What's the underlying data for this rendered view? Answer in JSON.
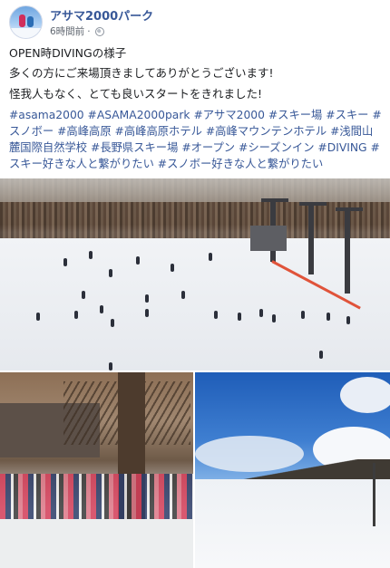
{
  "post": {
    "page_name": "アサマ2000パーク",
    "timestamp": "6時間前",
    "privacy_icon": "globe-icon",
    "lines": [
      "OPEN時DIVINGの様子",
      "多くの方にご来場頂きましてありがとうございます!",
      "怪我人もなく、とても良いスタートをきれました!"
    ],
    "hashtags": [
      "#asama2000",
      "#ASAMA2000park",
      "#アサマ2000",
      "#スキー場",
      "#スキー",
      "#スノボー",
      "#高峰高原",
      "#高峰高原ホテル",
      "#高峰マウンテンホテル",
      "#浅間山麓国際自然学校",
      "#長野県スキー場",
      "#オープン",
      "#シーズンイン",
      "#DIVING",
      "#スキー好きな人と繋がりたい",
      "#スノボー好きな人と繋がりたい"
    ]
  },
  "colors": {
    "link": "#385898",
    "text": "#1c1e21",
    "meta": "#606770"
  }
}
